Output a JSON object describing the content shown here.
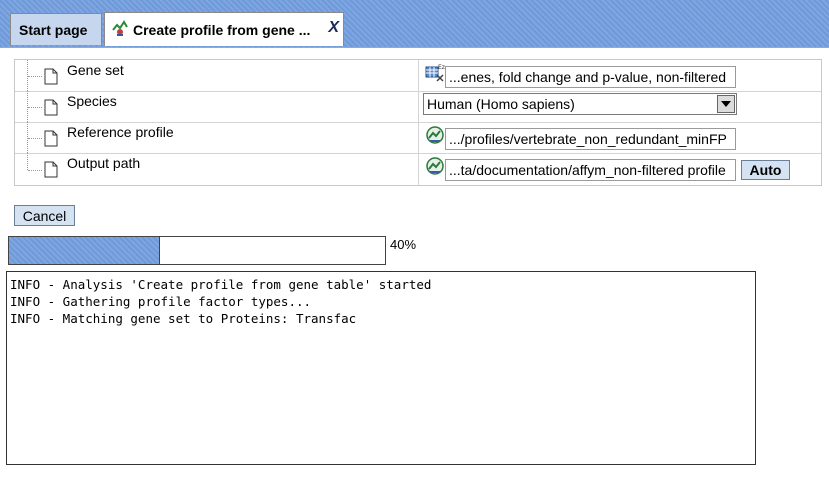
{
  "tabs": {
    "start_label": "Start page",
    "active_label": "Create profile from gene ...",
    "close_label": "X"
  },
  "params": [
    {
      "name": "Gene set",
      "value": "...enes, fold change and p-value, non-filtered",
      "icon": "table-icon"
    },
    {
      "name": "Species",
      "value": "Human (Homo sapiens)",
      "icon": "dropdown"
    },
    {
      "name": "Reference profile",
      "value": ".../profiles/vertebrate_non_redundant_minFP",
      "icon": "profile-icon"
    },
    {
      "name": "Output path",
      "value": "...ta/documentation/affym_non-filtered profile",
      "icon": "profile-icon"
    }
  ],
  "buttons": {
    "auto_label": "Auto",
    "cancel_label": "Cancel"
  },
  "progress": {
    "percent_text": "40%",
    "fraction": 0.4
  },
  "log": [
    "INFO - Analysis 'Create profile from gene table' started",
    "INFO - Gathering profile factor types...",
    "INFO - Matching gene set to Proteins: Transfac"
  ],
  "colors": {
    "accent": "#6f99d8",
    "tab_inactive": "#c6d6ee",
    "button_bg": "#d5e2f2"
  }
}
